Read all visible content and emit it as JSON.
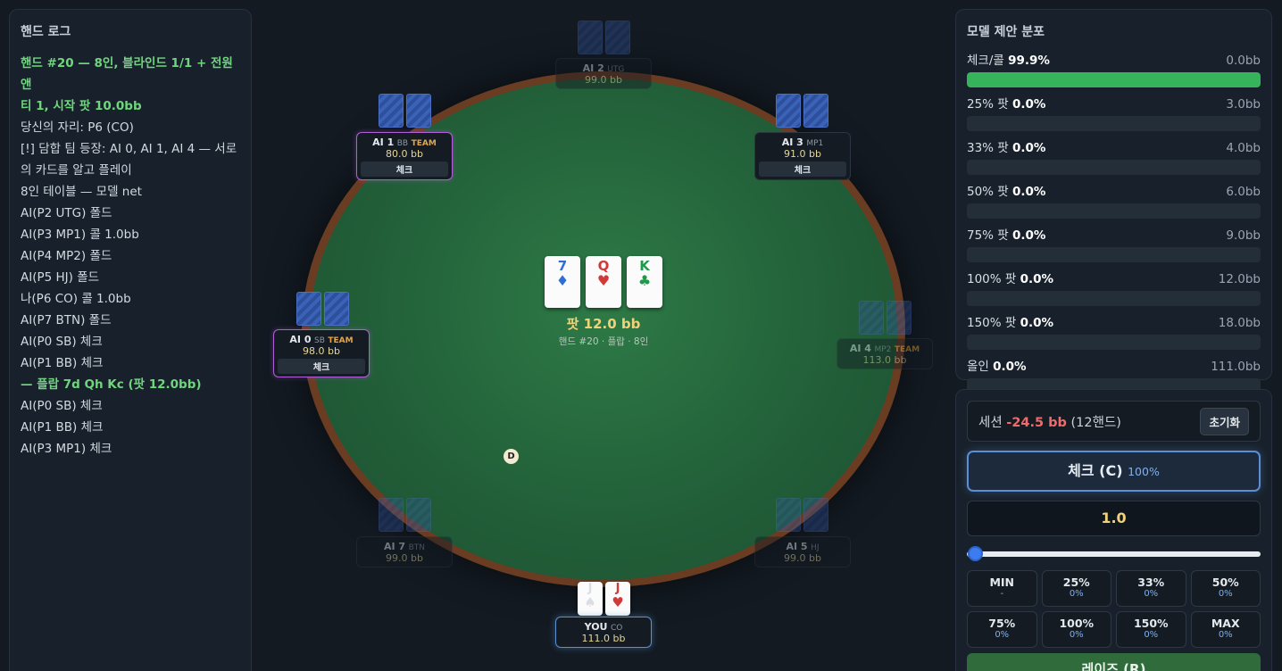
{
  "log": {
    "title": "핸드 로그",
    "lines": [
      {
        "text": "핸드 #20 — 8인, 블라인드 1/1 + 전원 앤",
        "hl": true
      },
      {
        "text": "티 1, 시작 팟 10.0bb",
        "hl": true
      },
      {
        "text": "당신의 자리: P6 (CO)",
        "hl": false
      },
      {
        "text": "[!] 담합 팀 등장: AI 0, AI 1, AI 4 — 서로",
        "hl": false
      },
      {
        "text": "의 카드를 알고 플레이",
        "hl": false
      },
      {
        "text": "8인 테이블 — 모델 net",
        "hl": false
      },
      {
        "text": "AI(P2 UTG) 폴드",
        "hl": false
      },
      {
        "text": "AI(P3 MP1) 콜 1.0bb",
        "hl": false
      },
      {
        "text": "AI(P4 MP2) 폴드",
        "hl": false
      },
      {
        "text": "AI(P5 HJ) 폴드",
        "hl": false
      },
      {
        "text": "나(P6 CO) 콜 1.0bb",
        "hl": false
      },
      {
        "text": "AI(P7 BTN) 폴드",
        "hl": false
      },
      {
        "text": "AI(P0 SB) 체크",
        "hl": false
      },
      {
        "text": "AI(P1 BB) 체크",
        "hl": false
      },
      {
        "text": "— 플랍 7d Qh Kc (팟 12.0bb)",
        "hl": true
      },
      {
        "text": "AI(P0 SB) 체크",
        "hl": false
      },
      {
        "text": "AI(P1 BB) 체크",
        "hl": false
      },
      {
        "text": "AI(P3 MP1) 체크",
        "hl": false
      }
    ]
  },
  "table": {
    "board": [
      {
        "rank": "7",
        "suit": "♦",
        "color": "blue"
      },
      {
        "rank": "Q",
        "suit": "♥",
        "color": "red"
      },
      {
        "rank": "K",
        "suit": "♣",
        "color": "green"
      }
    ],
    "pot": "팟 12.0 bb",
    "pot_sub": "핸드 #20 · 플랍 · 8인",
    "dealer": "D",
    "seats": {
      "ai2": {
        "name": "AI 2",
        "pos": "UTG",
        "team": "",
        "stack": "99.0 bb",
        "action": ""
      },
      "ai1": {
        "name": "AI 1",
        "pos": "BB",
        "team": "TEAM",
        "stack": "80.0 bb",
        "action": "체크"
      },
      "ai3": {
        "name": "AI 3",
        "pos": "MP1",
        "team": "",
        "stack": "91.0 bb",
        "action": "체크"
      },
      "ai0": {
        "name": "AI 0",
        "pos": "SB",
        "team": "TEAM",
        "stack": "98.0 bb",
        "action": "체크"
      },
      "ai4": {
        "name": "AI 4",
        "pos": "MP2",
        "team": "TEAM",
        "stack": "113.0 bb",
        "action": ""
      },
      "ai7": {
        "name": "AI 7",
        "pos": "BTN",
        "team": "",
        "stack": "99.0 bb",
        "action": ""
      },
      "ai5": {
        "name": "AI 5",
        "pos": "HJ",
        "team": "",
        "stack": "99.0 bb",
        "action": ""
      },
      "you": {
        "name": "YOU",
        "pos": "CO",
        "team": "",
        "stack": "111.0 bb",
        "action": ""
      }
    },
    "hero_cards": [
      {
        "rank": "J",
        "suit": "♠",
        "color": "black"
      },
      {
        "rank": "J",
        "suit": "♥",
        "color": "red"
      }
    ]
  },
  "dist": {
    "title": "모델 제안 분포",
    "rows": [
      {
        "label": "체크/콜",
        "pct": "99.9%",
        "bb": "0.0bb",
        "fill": 0.999
      },
      {
        "label": "25% 팟",
        "pct": "0.0%",
        "bb": "3.0bb",
        "fill": 0
      },
      {
        "label": "33% 팟",
        "pct": "0.0%",
        "bb": "4.0bb",
        "fill": 0
      },
      {
        "label": "50% 팟",
        "pct": "0.0%",
        "bb": "6.0bb",
        "fill": 0
      },
      {
        "label": "75% 팟",
        "pct": "0.0%",
        "bb": "9.0bb",
        "fill": 0
      },
      {
        "label": "100% 팟",
        "pct": "0.0%",
        "bb": "12.0bb",
        "fill": 0
      },
      {
        "label": "150% 팟",
        "pct": "0.0%",
        "bb": "18.0bb",
        "fill": 0
      },
      {
        "label": "올인",
        "pct": "0.0%",
        "bb": "111.0bb",
        "fill": 0
      }
    ],
    "bar_color": "#35b45c"
  },
  "controls": {
    "session_label": "세션",
    "session_value": "-24.5 bb",
    "session_hands": "(12핸드)",
    "reset": "초기화",
    "check_label": "체크 (C)",
    "check_pct": "100%",
    "amount": "1.0",
    "slider_fraction": 0,
    "sizes": [
      {
        "label": "MIN",
        "sub": "-"
      },
      {
        "label": "25%",
        "sub": "0%"
      },
      {
        "label": "33%",
        "sub": "0%"
      },
      {
        "label": "50%",
        "sub": "0%"
      },
      {
        "label": "75%",
        "sub": "0%"
      },
      {
        "label": "100%",
        "sub": "0%"
      },
      {
        "label": "150%",
        "sub": "0%"
      },
      {
        "label": "MAX",
        "sub": "0%"
      }
    ],
    "raise_label": "레이즈 (R)"
  }
}
